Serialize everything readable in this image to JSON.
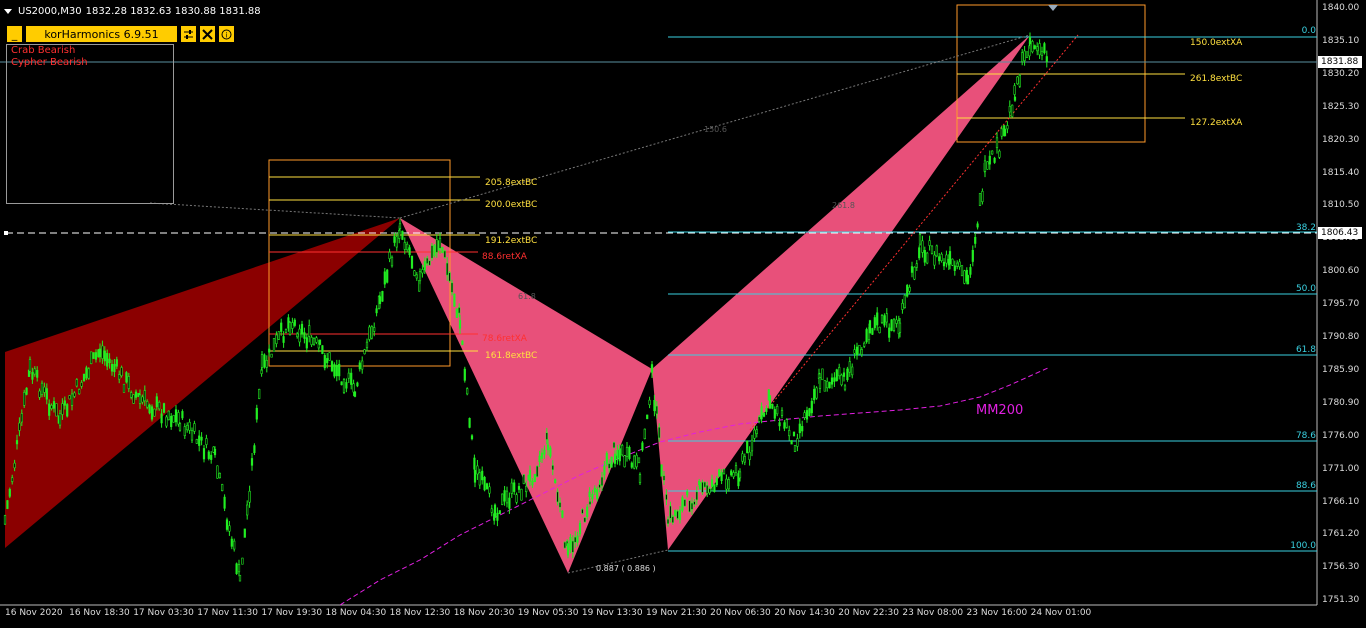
{
  "symbol_header": {
    "symbol": "US2000,M30",
    "ohlc": "1832.28 1832.63 1830.88 1831.88"
  },
  "indicator": {
    "minimize_label": "_",
    "title": "korHarmonics 6.9.51",
    "settings_icon": "sliders-icon",
    "tools_icon": "tools-icon",
    "info_icon": "info-icon",
    "info_glyph": "i",
    "patterns": [
      "Crab Bearish",
      "Cypher Bearish"
    ]
  },
  "price_axis": {
    "labels": [
      "1840.00",
      "1835.10",
      "1830.20",
      "1825.30",
      "1820.30",
      "1815.40",
      "1810.50",
      "1805.60",
      "1800.60",
      "1795.70",
      "1790.80",
      "1785.90",
      "1780.90",
      "1776.00",
      "1771.00",
      "1766.10",
      "1761.20",
      "1756.30",
      "1751.30"
    ],
    "current_price": "1831.88",
    "crosshair_price": "1806.43"
  },
  "time_axis": {
    "labels": [
      "16 Nov 2020",
      "16 Nov 18:30",
      "17 Nov 03:30",
      "17 Nov 11:30",
      "17 Nov 19:30",
      "18 Nov 04:30",
      "18 Nov 12:30",
      "18 Nov 20:30",
      "19 Nov 05:30",
      "19 Nov 13:30",
      "19 Nov 21:30",
      "20 Nov 06:30",
      "20 Nov 14:30",
      "20 Nov 22:30",
      "23 Nov 08:00",
      "23 Nov 16:00",
      "24 Nov 01:00"
    ]
  },
  "fib_levels": [
    "0.0",
    "38.2",
    "50.0",
    "61.8",
    "78.6",
    "88.6",
    "100.0"
  ],
  "pattern_levels_left": {
    "ext_205": "205.8extBC",
    "ext_200": "200.0extBC",
    "ext_191": "191.2extBC",
    "ret_886": "88.6retXA",
    "ret_786": "78.6retXA",
    "ext_161": "161.8extBC"
  },
  "pattern_levels_right": {
    "ext_150": "150.0extXA",
    "ext_261": "261.8extBC",
    "ext_127": "127.2extXA"
  },
  "ratios": {
    "cd_ratio": "0.887 ( 0.886 )",
    "xd_faint": "150.6",
    "bd_faint": "261.8",
    "ab_faint": "61.8"
  },
  "moving_average": {
    "label": "MM200"
  },
  "colors": {
    "background": "#000000",
    "candle": "#22ee22",
    "pattern_fill_left": "#8b0000",
    "pattern_fill_right": "#e8507a",
    "fib_line": "#3ad0e0",
    "ma_line": "#e020e0",
    "level_yellow": "#ffe040",
    "level_red": "#ff3030",
    "toolbar": "#ffcc00"
  }
}
